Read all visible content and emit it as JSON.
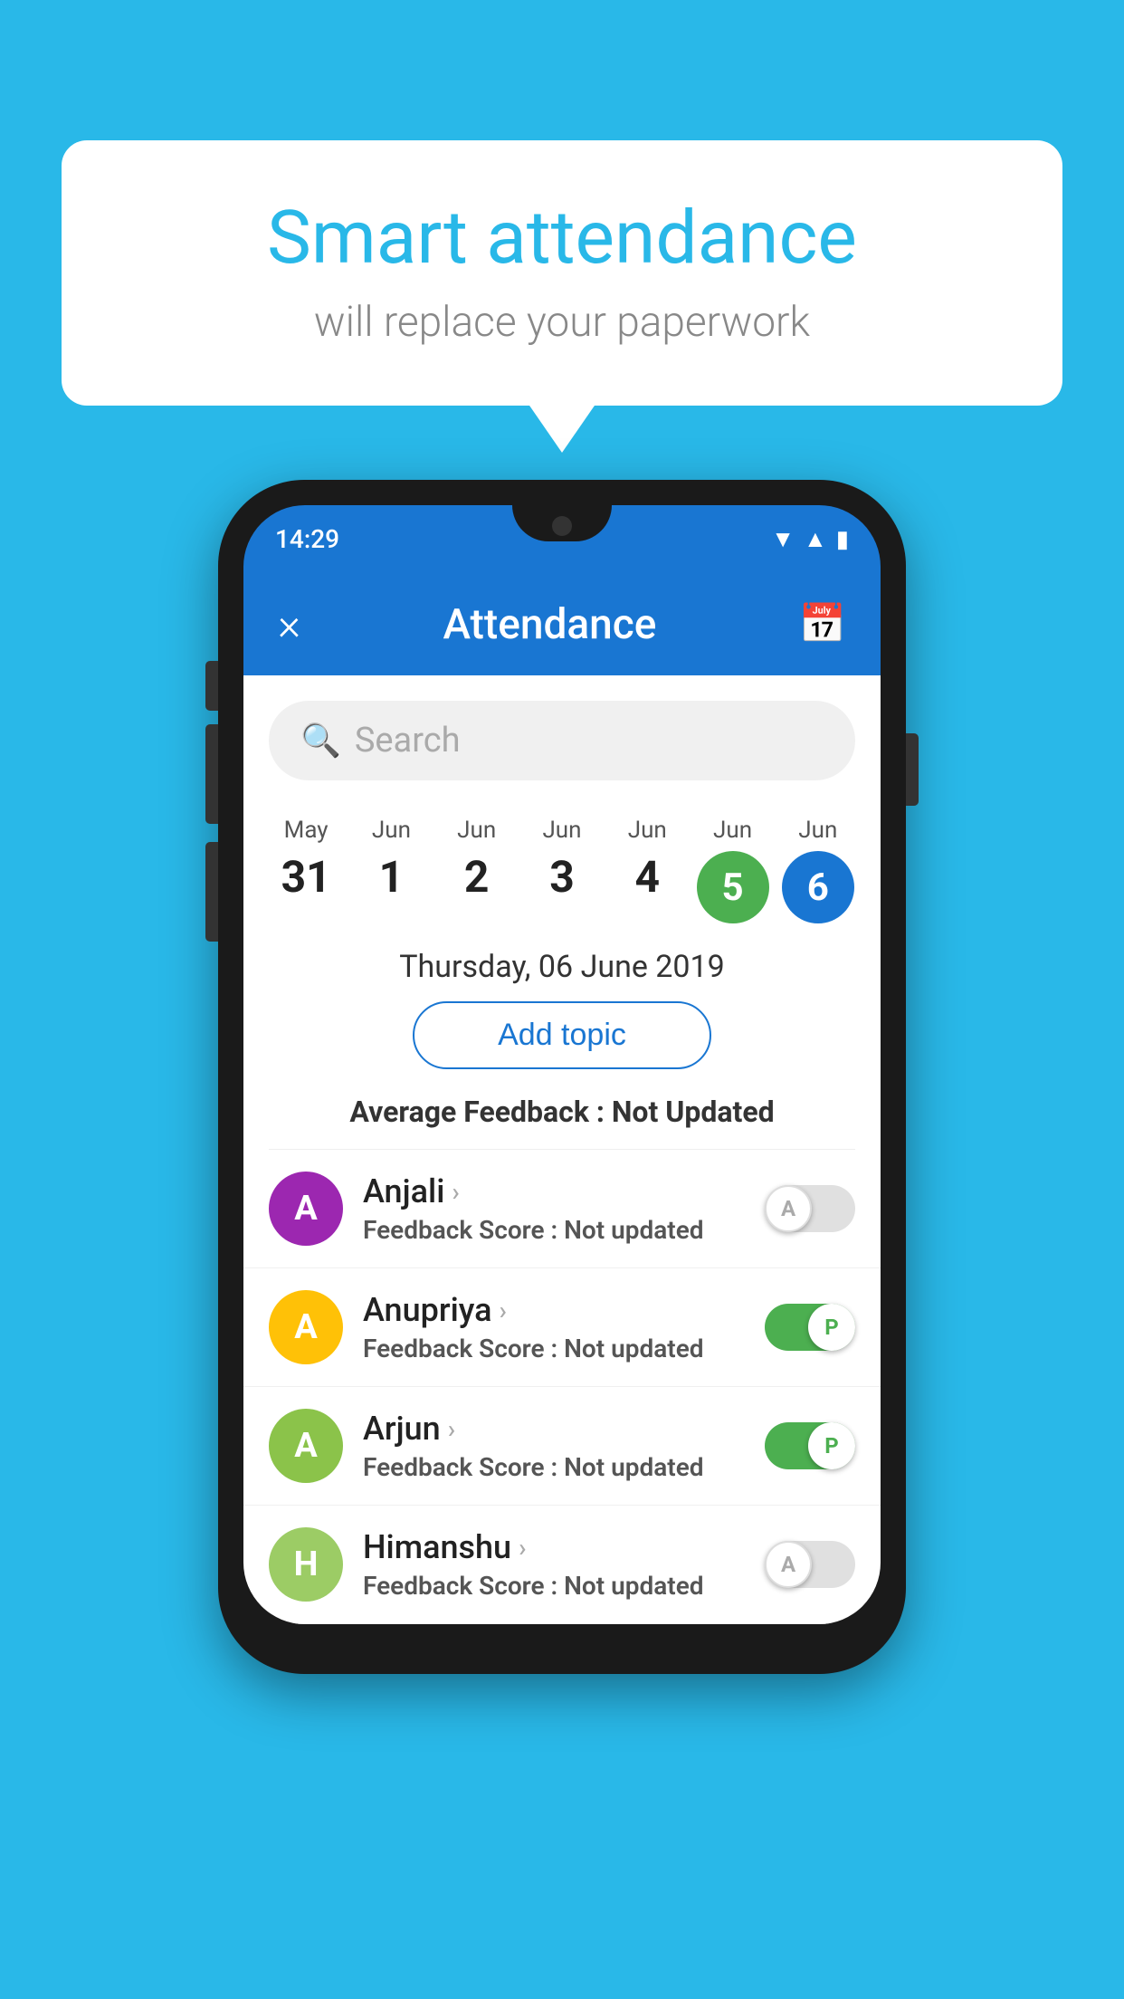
{
  "background_color": "#29b8e8",
  "bubble": {
    "title": "Smart attendance",
    "subtitle": "will replace your paperwork"
  },
  "phone": {
    "status_bar": {
      "time": "14:29"
    },
    "header": {
      "close_label": "×",
      "title": "Attendance",
      "calendar_icon": "📅"
    },
    "search": {
      "placeholder": "Search"
    },
    "calendar": {
      "dates": [
        {
          "month": "May",
          "day": "31",
          "type": "normal"
        },
        {
          "month": "Jun",
          "day": "1",
          "type": "normal"
        },
        {
          "month": "Jun",
          "day": "2",
          "type": "normal"
        },
        {
          "month": "Jun",
          "day": "3",
          "type": "normal"
        },
        {
          "month": "Jun",
          "day": "4",
          "type": "normal"
        },
        {
          "month": "Jun",
          "day": "5",
          "type": "green"
        },
        {
          "month": "Jun",
          "day": "6",
          "type": "blue"
        }
      ]
    },
    "selected_date_label": "Thursday, 06 June 2019",
    "add_topic_label": "Add topic",
    "avg_feedback_prefix": "Average Feedback : ",
    "avg_feedback_value": "Not Updated",
    "students": [
      {
        "name": "Anjali",
        "avatar_letter": "A",
        "avatar_color": "purple",
        "feedback_label": "Feedback Score : ",
        "feedback_value": "Not updated",
        "toggle": "off",
        "toggle_letter": "A"
      },
      {
        "name": "Anupriya",
        "avatar_letter": "A",
        "avatar_color": "yellow",
        "feedback_label": "Feedback Score : ",
        "feedback_value": "Not updated",
        "toggle": "on",
        "toggle_letter": "P"
      },
      {
        "name": "Arjun",
        "avatar_letter": "A",
        "avatar_color": "light-green",
        "feedback_label": "Feedback Score : ",
        "feedback_value": "Not updated",
        "toggle": "on",
        "toggle_letter": "P"
      },
      {
        "name": "Himanshu",
        "avatar_letter": "H",
        "avatar_color": "olive",
        "feedback_label": "Feedback Score : ",
        "feedback_value": "Not updated",
        "toggle": "off",
        "toggle_letter": "A"
      }
    ]
  }
}
